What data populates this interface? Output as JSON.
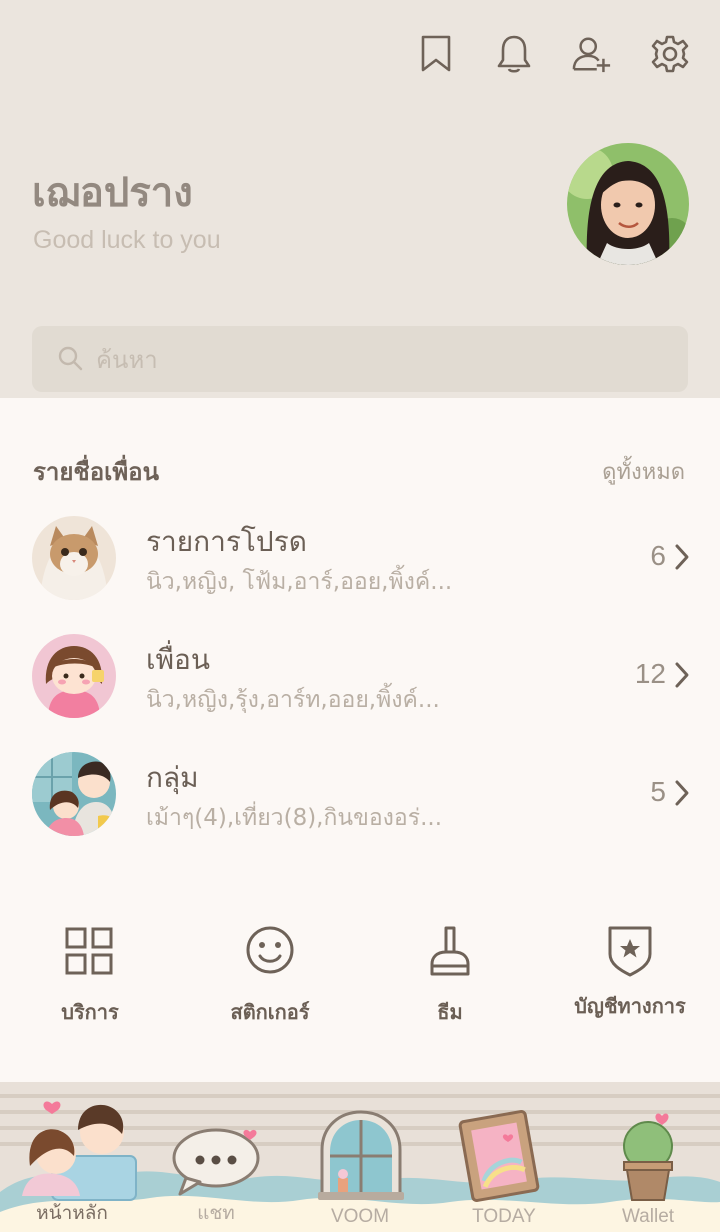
{
  "header": {
    "icons": [
      "bookmark-icon",
      "bell-icon",
      "add-friend-icon",
      "gear-icon"
    ]
  },
  "profile": {
    "name": "เฌอปราง",
    "status": "Good luck to you"
  },
  "search": {
    "placeholder": "ค้นหา"
  },
  "friends_section": {
    "title": "รายชื่อเพื่อน",
    "see_all": "ดูทั้งหมด",
    "rows": [
      {
        "title": "รายการโปรด",
        "subtitle": "นิว,หญิง, โฟ้ม,อาร์,ออย,พิ้งค์...",
        "count": "6"
      },
      {
        "title": "เพื่อน",
        "subtitle": "นิว,หญิง,รุ้ง,อาร์ท,ออย,พิ้งค์...",
        "count": "12"
      },
      {
        "title": "กลุ่ม",
        "subtitle": "เม้าๆ(4),เที่ยว(8),กินของอร่...",
        "count": "5"
      }
    ]
  },
  "services": [
    {
      "label": "บริการ",
      "icon": "grid-icon"
    },
    {
      "label": "สติกเกอร์",
      "icon": "smiley-icon"
    },
    {
      "label": "ธีม",
      "icon": "brush-icon"
    },
    {
      "label": "บัญชีทางการ",
      "icon": "official-badge-icon"
    }
  ],
  "tabs": [
    {
      "label": "หน้าหลัก",
      "active": true
    },
    {
      "label": "แชท",
      "active": false
    },
    {
      "label": "VOOM",
      "active": false
    },
    {
      "label": "TODAY",
      "active": false
    },
    {
      "label": "Wallet",
      "active": false
    }
  ],
  "colors": {
    "header_bg": "#ebe5de",
    "body_bg": "#fcf8f5",
    "accent_brown": "#6b5f55"
  }
}
